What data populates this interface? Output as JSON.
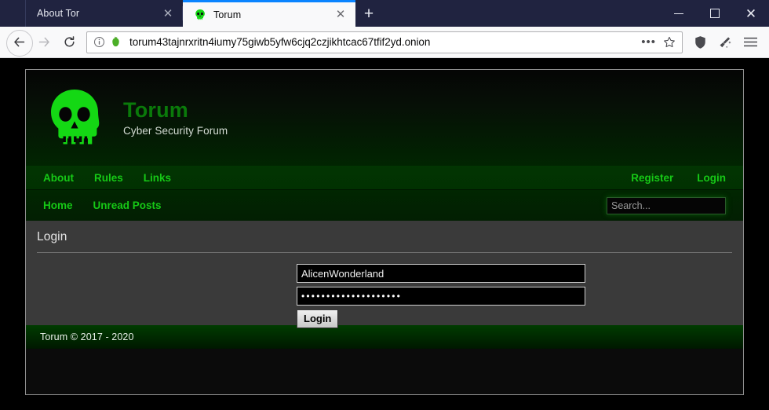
{
  "browser": {
    "tabs": [
      {
        "title": "About Tor",
        "favicon": "none",
        "active": false,
        "close_label": "✕"
      },
      {
        "title": "Torum",
        "favicon": "skull-favicon",
        "active": true,
        "close_label": "✕"
      }
    ],
    "new_tab_label": "+",
    "window_controls": {
      "minimize": "minimize-icon",
      "maximize": "maximize-icon",
      "close": "✕"
    },
    "toolbar": {
      "back": "back-arrow-icon",
      "forward": "forward-arrow-icon",
      "reload": "reload-icon",
      "identity": "info-icon",
      "onion": "onion-icon",
      "url": "torum43tajnrxritn4iumy75giwb5yfw6cjq2czjikhtcac67tfif2yd.onion",
      "page_actions": "•••",
      "bookmark": "star-icon",
      "shield": "shield-icon",
      "new_identity": "broom-icon",
      "menu": "hamburger-menu-icon"
    }
  },
  "site": {
    "logo": "skull-logo",
    "title": "Torum",
    "subtitle": "Cyber Security Forum",
    "nav_top_left": [
      {
        "label": "About"
      },
      {
        "label": "Rules"
      },
      {
        "label": "Links"
      }
    ],
    "nav_top_right": [
      {
        "label": "Register"
      },
      {
        "label": "Login"
      }
    ],
    "nav_bottom_left": [
      {
        "label": "Home"
      },
      {
        "label": "Unread Posts"
      }
    ],
    "search": {
      "value": "",
      "placeholder": "Search..."
    },
    "panel": {
      "title": "Login",
      "username": {
        "value": "AlicenWonderland",
        "placeholder": ""
      },
      "password": {
        "value": "••••••••••••••••••••",
        "placeholder": ""
      },
      "submit_label": "Login"
    },
    "footer": {
      "text": "Torum © 2017 - 2020"
    }
  },
  "colors": {
    "brand_green": "#0a7a0a",
    "link_green": "#16c916",
    "skull_green": "#14d814",
    "panel_gray": "#3a3a3a",
    "chrome_navy": "#202340",
    "active_tab_accent": "#0a84ff"
  }
}
